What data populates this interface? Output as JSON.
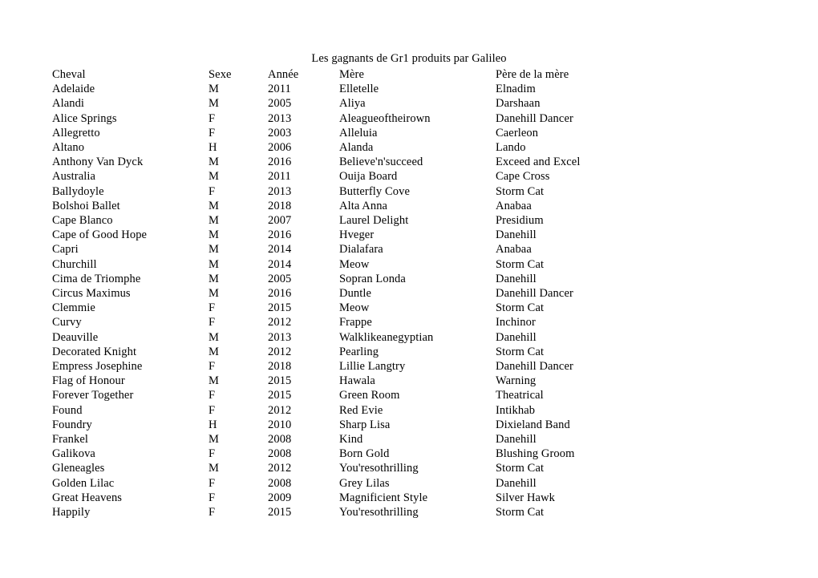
{
  "document": {
    "title": "Les gagnants de Gr1 produits par Galileo"
  },
  "table": {
    "columns": [
      {
        "key": "name",
        "label": "Cheval"
      },
      {
        "key": "sex",
        "label": "Sexe"
      },
      {
        "key": "year",
        "label": "Année"
      },
      {
        "key": "dam",
        "label": "Mère"
      },
      {
        "key": "sire",
        "label": "Père de la mère"
      }
    ],
    "rows": [
      {
        "name": "Adelaide",
        "sex": "M",
        "year": "2011",
        "dam": "Elletelle",
        "sire": "Elnadim"
      },
      {
        "name": "Alandi",
        "sex": "M",
        "year": "2005",
        "dam": "Aliya",
        "sire": "Darshaan"
      },
      {
        "name": "Alice Springs",
        "sex": "F",
        "year": "2013",
        "dam": "Aleagueoftheirown",
        "sire": "Danehill Dancer"
      },
      {
        "name": "Allegretto",
        "sex": "F",
        "year": "2003",
        "dam": "Alleluia",
        "sire": "Caerleon"
      },
      {
        "name": "Altano",
        "sex": "H",
        "year": "2006",
        "dam": "Alanda",
        "sire": "Lando"
      },
      {
        "name": "Anthony Van Dyck",
        "sex": "M",
        "year": "2016",
        "dam": "Believe'n'succeed",
        "sire": "Exceed and Excel"
      },
      {
        "name": "Australia",
        "sex": "M",
        "year": "2011",
        "dam": "Ouija Board",
        "sire": "Cape Cross"
      },
      {
        "name": "Ballydoyle",
        "sex": "F",
        "year": "2013",
        "dam": "Butterfly Cove",
        "sire": "Storm Cat"
      },
      {
        "name": "Bolshoi Ballet",
        "sex": "M",
        "year": "2018",
        "dam": "Alta Anna",
        "sire": "Anabaa"
      },
      {
        "name": "Cape Blanco",
        "sex": "M",
        "year": "2007",
        "dam": "Laurel Delight",
        "sire": "Presidium"
      },
      {
        "name": "Cape of Good Hope",
        "sex": "M",
        "year": "2016",
        "dam": "Hveger",
        "sire": "Danehill"
      },
      {
        "name": "Capri",
        "sex": "M",
        "year": "2014",
        "dam": "Dialafara",
        "sire": "Anabaa"
      },
      {
        "name": "Churchill",
        "sex": "M",
        "year": "2014",
        "dam": "Meow",
        "sire": "Storm Cat"
      },
      {
        "name": "Cima de Triomphe",
        "sex": "M",
        "year": "2005",
        "dam": "Sopran Londa",
        "sire": "Danehill"
      },
      {
        "name": "Circus Maximus",
        "sex": "M",
        "year": "2016",
        "dam": "Duntle",
        "sire": "Danehill Dancer"
      },
      {
        "name": "Clemmie",
        "sex": "F",
        "year": "2015",
        "dam": "Meow",
        "sire": "Storm Cat"
      },
      {
        "name": "Curvy",
        "sex": "F",
        "year": "2012",
        "dam": "Frappe",
        "sire": "Inchinor"
      },
      {
        "name": "Deauville",
        "sex": "M",
        "year": "2013",
        "dam": "Walklikeanegyptian",
        "sire": "Danehill"
      },
      {
        "name": "Decorated Knight",
        "sex": "M",
        "year": "2012",
        "dam": "Pearling",
        "sire": "Storm Cat"
      },
      {
        "name": "Empress Josephine",
        "sex": "F",
        "year": "2018",
        "dam": "Lillie Langtry",
        "sire": "Danehill Dancer"
      },
      {
        "name": "Flag of Honour",
        "sex": "M",
        "year": "2015",
        "dam": "Hawala",
        "sire": "Warning"
      },
      {
        "name": "Forever Together",
        "sex": "F",
        "year": "2015",
        "dam": "Green Room",
        "sire": "Theatrical"
      },
      {
        "name": "Found",
        "sex": "F",
        "year": "2012",
        "dam": "Red Evie",
        "sire": "Intikhab"
      },
      {
        "name": "Foundry",
        "sex": "H",
        "year": "2010",
        "dam": "Sharp Lisa",
        "sire": "Dixieland Band"
      },
      {
        "name": "Frankel",
        "sex": "M",
        "year": "2008",
        "dam": "Kind",
        "sire": "Danehill"
      },
      {
        "name": "Galikova",
        "sex": "F",
        "year": "2008",
        "dam": "Born Gold",
        "sire": "Blushing Groom"
      },
      {
        "name": "Gleneagles",
        "sex": "M",
        "year": "2012",
        "dam": "You'resothrilling",
        "sire": "Storm Cat"
      },
      {
        "name": "Golden Lilac",
        "sex": "F",
        "year": "2008",
        "dam": "Grey Lilas",
        "sire": "Danehill"
      },
      {
        "name": "Great Heavens",
        "sex": "F",
        "year": "2009",
        "dam": "Magnificient Style",
        "sire": "Silver Hawk"
      },
      {
        "name": "Happily",
        "sex": "F",
        "year": "2015",
        "dam": "You'resothrilling",
        "sire": "Storm Cat"
      }
    ]
  }
}
